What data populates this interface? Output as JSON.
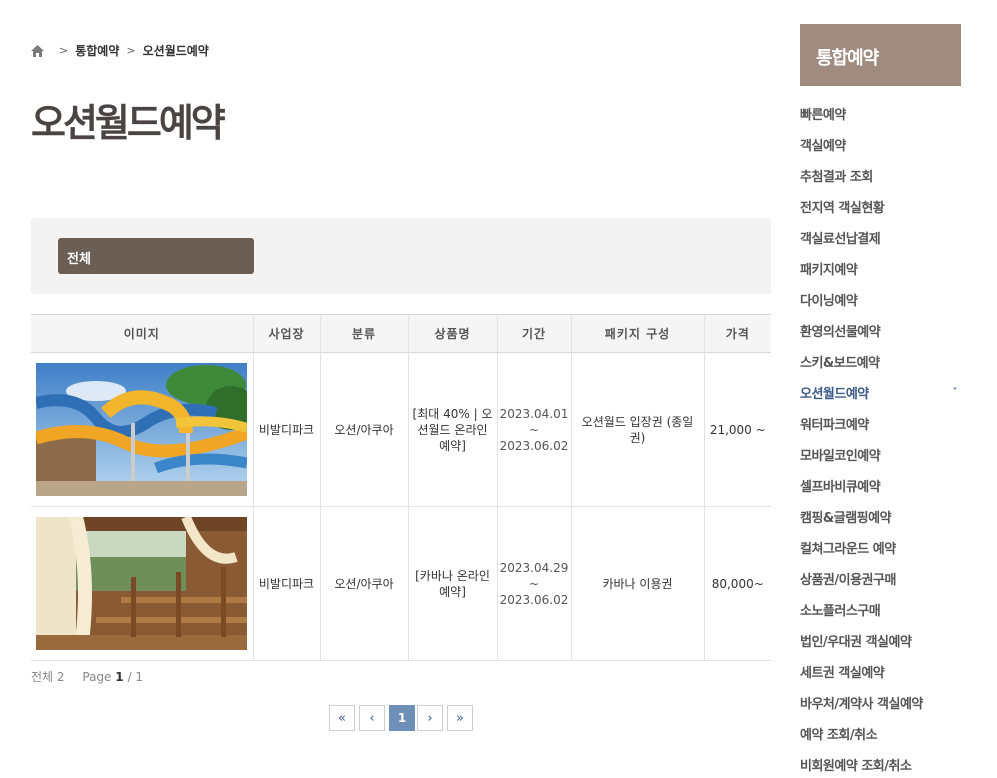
{
  "breadcrumb": {
    "level1": "통합예약",
    "level2": "오션월드예약",
    "sep": ">"
  },
  "page_title": "오션월드예약",
  "filter": {
    "label": "전체"
  },
  "table": {
    "headers": [
      "이미지",
      "사업장",
      "분류",
      "상품명",
      "기간",
      "패키지 구성",
      "가격"
    ],
    "rows": [
      {
        "venue": "비발디파크",
        "category": "오션/아쿠아",
        "product": "[최대 40% | 오션월드 온라인 예약]",
        "period_start": "2023.04.01",
        "period_tilde": "~",
        "period_end": "2023.06.02",
        "package": "오션월드 입장권 (종일권)",
        "price": "21,000 ~"
      },
      {
        "venue": "비발디파크",
        "category": "오션/아쿠아",
        "product": "[카바나 온라인 예약]",
        "period_start": "2023.04.29",
        "period_tilde": "~",
        "period_end": "2023.06.02",
        "package": "카바나 이용권",
        "price": "80,000~"
      }
    ]
  },
  "summary": {
    "total_label": "전체",
    "total_count": "2",
    "page_label": "Page",
    "current_page": "1",
    "page_sep": "/",
    "total_pages": "1"
  },
  "pagination": {
    "first": "«",
    "prev": "‹",
    "current": "1",
    "next": "›",
    "last": "»"
  },
  "sidebar": {
    "title": "통합예약",
    "items": [
      "빠른예약",
      "객실예약",
      "추첨결과 조회",
      "전지역 객실현황",
      "객실료선납결제",
      "패키지예약",
      "다이닝예약",
      "환영의선물예약",
      "스키&보드예약",
      "오션월드예약",
      "워터파크예약",
      "모바일코인예약",
      "셀프바비큐예약",
      "캠핑&글램핑예약",
      "컬쳐그라운드 예약",
      "상품권/이용권구매",
      "소노플러스구매",
      "법인/우대권 객실예약",
      "세트권 객실예약",
      "바우처/계약사 객실예약",
      "예약 조회/취소",
      "비회원예약 조회/취소"
    ],
    "active_index": 9,
    "active_chevron": "˅"
  },
  "colors": {
    "accent": "#3d5b87",
    "brand": "#a08c7f",
    "filter": "#6b5e55"
  }
}
